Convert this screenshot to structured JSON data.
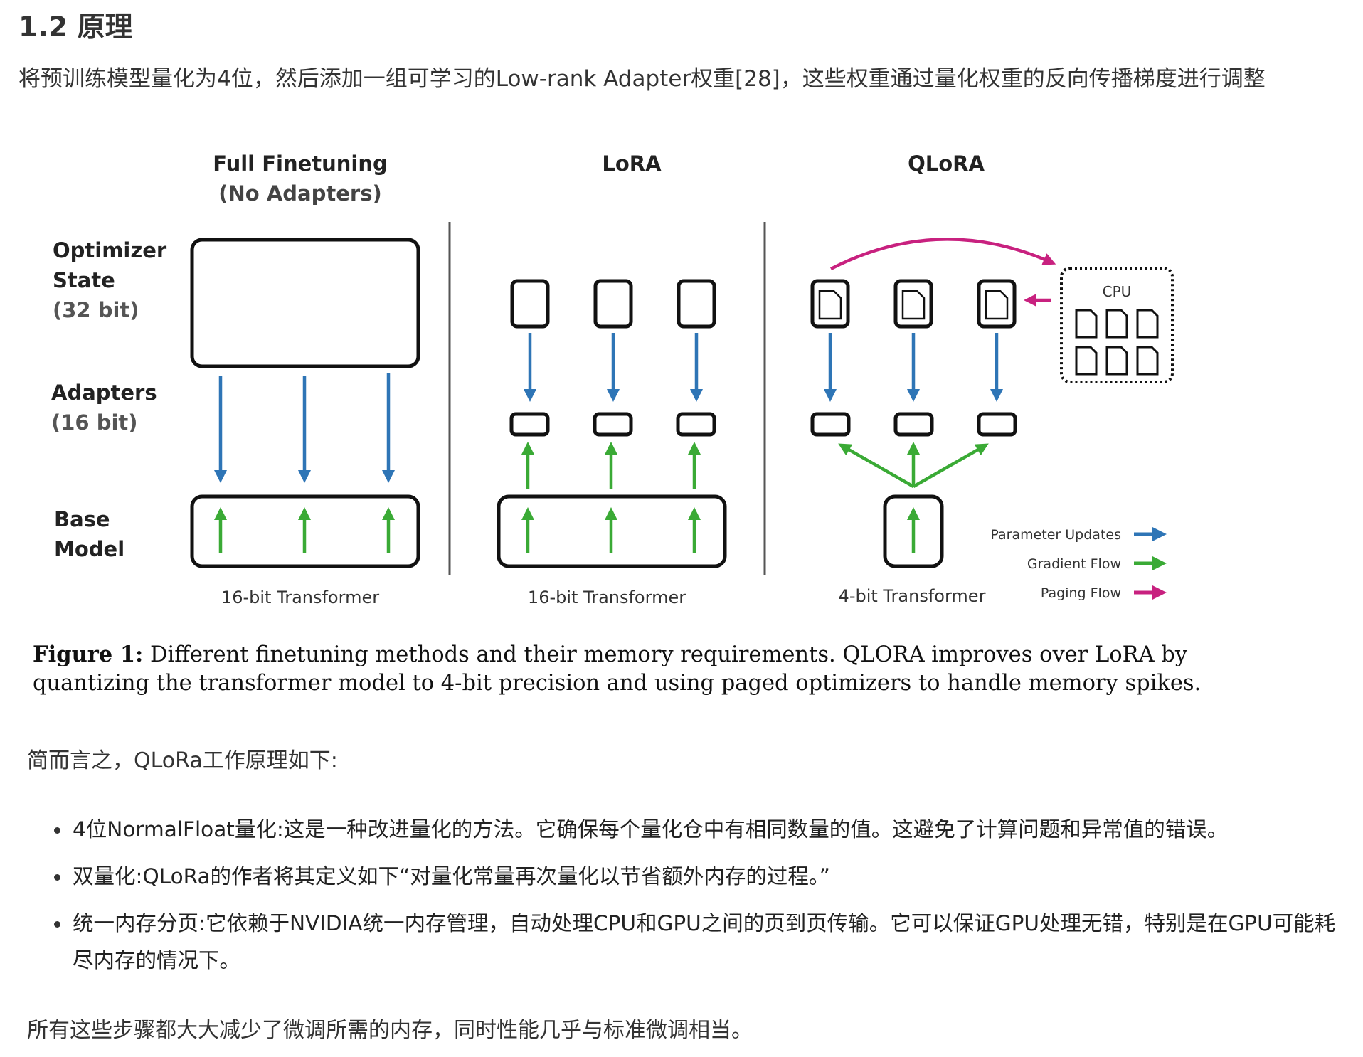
{
  "section": {
    "heading": "1.2 原理",
    "intro": "将预训练模型量化为4位，然后添加一组可学习的Low-rank Adapter权重[28]，这些权重通过量化权重的反向传播梯度进行调整"
  },
  "figure": {
    "columns": {
      "full_title_1": "Full Finetuning",
      "full_title_2": "(No Adapters)",
      "lora_title": "LoRA",
      "qlora_title": "QLoRA"
    },
    "rows": {
      "optimizer_1": "Optimizer",
      "optimizer_2": "State",
      "optimizer_3": "(32 bit)",
      "adapters_1": "Adapters",
      "adapters_2": "(16 bit)",
      "base_1": "Base",
      "base_2": "Model"
    },
    "transformers": {
      "full": "16-bit Transformer",
      "lora": "16-bit Transformer",
      "qlora": "4-bit Transformer"
    },
    "cpu_label": "CPU",
    "legend": {
      "parameter_updates": "Parameter Updates",
      "gradient_flow": "Gradient Flow",
      "paging_flow": "Paging Flow"
    },
    "colors": {
      "parameter_updates": "#2e75b6",
      "gradient_flow": "#3aaa35",
      "paging_flow": "#c8217f"
    },
    "caption_label": "Figure 1:",
    "caption_text": " Different finetuning methods and their memory requirements. QLORA improves over LoRA by quantizing the transformer model to 4-bit precision and using paged optimizers to handle memory spikes."
  },
  "summary": "简而言之，QLoRa工作原理如下:",
  "bullets": [
    "4位NormalFloat量化:这是一种改进量化的方法。它确保每个量化仓中有相同数量的值。这避免了计算问题和异常值的错误。",
    "双量化:QLoRa的作者将其定义如下“对量化常量再次量化以节省额外内存的过程。”",
    "统一内存分页:它依赖于NVIDIA统一内存管理，自动处理CPU和GPU之间的页到页传输。它可以保证GPU处理无错，特别是在GPU可能耗尽内存的情况下。"
  ],
  "conclusion": "所有这些步骤都大大减少了微调所需的内存，同时性能几乎与标准微调相当。"
}
